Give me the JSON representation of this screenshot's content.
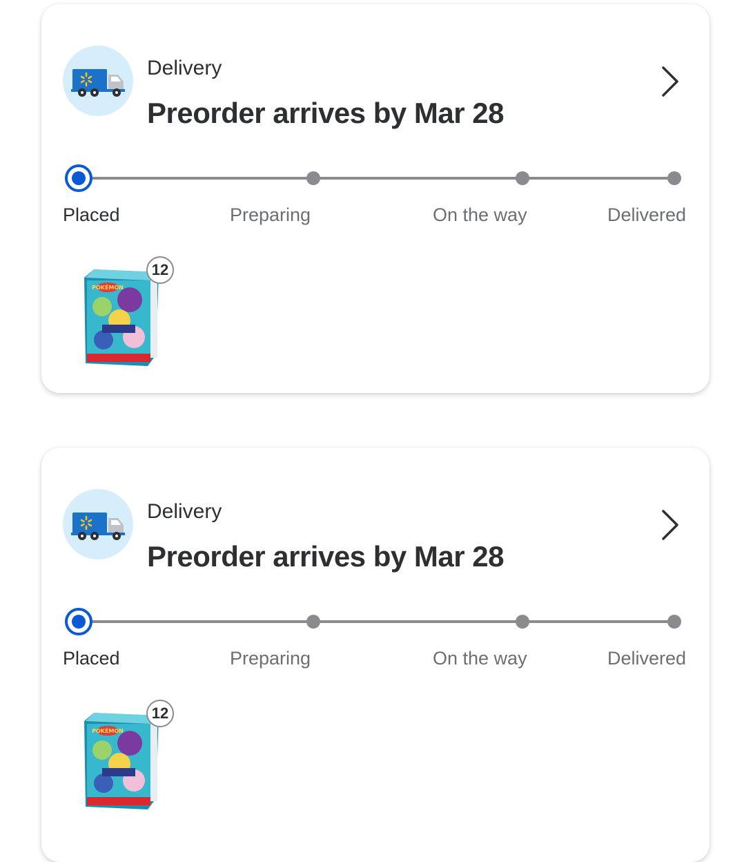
{
  "orders": [
    {
      "type_label": "Delivery",
      "headline": "Preorder arrives by Mar 28",
      "steps": [
        "Placed",
        "Preparing",
        "On the way",
        "Delivered"
      ],
      "current_step": 1,
      "items": [
        {
          "name": "product-image",
          "quantity": "12"
        }
      ]
    },
    {
      "type_label": "Delivery",
      "headline": "Preorder arrives by Mar 28",
      "steps": [
        "Placed",
        "Preparing",
        "On the way",
        "Delivered"
      ],
      "current_step": 1,
      "items": [
        {
          "name": "product-image",
          "quantity": "12"
        }
      ]
    }
  ],
  "colors": {
    "accent": "#0a5ad6",
    "track": "#8a8b8f",
    "truck_circle": "#d6eefb",
    "truck_body": "#1a73c8",
    "spark": "#ffc220"
  },
  "icons": {
    "service": "delivery-truck-icon",
    "navigate": "chevron-right-icon",
    "step_active": "radio-selected-icon"
  }
}
